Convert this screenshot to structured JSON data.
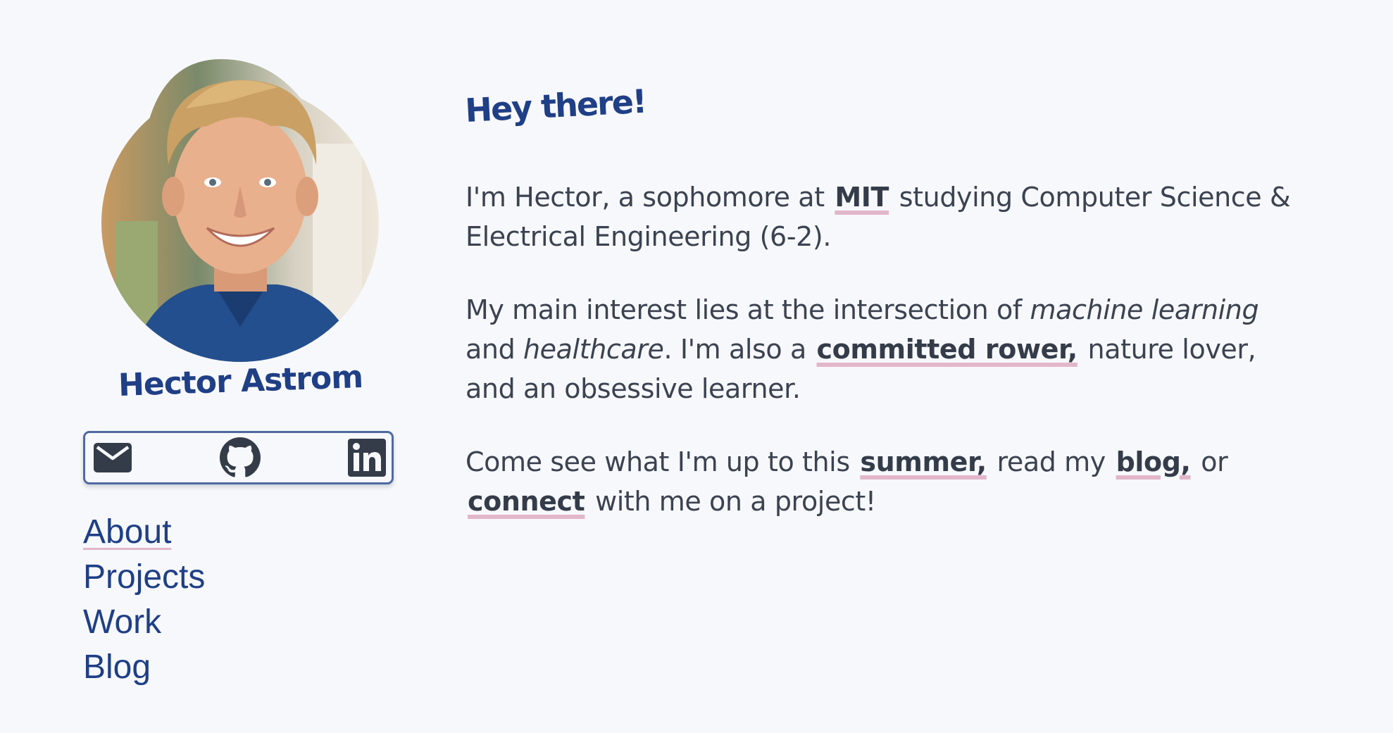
{
  "profile": {
    "name": "Hector Astrom",
    "avatar_alt": "profile-photo"
  },
  "social": [
    {
      "icon": "mail-icon"
    },
    {
      "icon": "github-icon"
    },
    {
      "icon": "linkedin-icon"
    }
  ],
  "nav": {
    "items": [
      {
        "label": "About",
        "active": true
      },
      {
        "label": "Projects"
      },
      {
        "label": "Work"
      },
      {
        "label": "Blog"
      }
    ]
  },
  "intro": {
    "greeting": "Hey there!",
    "p1": {
      "before": "I'm Hector, a sophomore at ",
      "link": "MIT",
      "after": " studying Computer Science & Electrical Engineering (6-2)."
    },
    "p2": {
      "before": "My main interest lies at the intersection of ",
      "em1": "machine learning",
      "mid1": " and ",
      "em2": "healthcare",
      "mid2": ". I'm also a ",
      "link": "committed rower,",
      "after": " nature lover, and an obsessive learner."
    },
    "p3": {
      "before": "Come see what I'm up to this ",
      "link1": "summer,",
      "mid1": " read my ",
      "link2": "blog,",
      "mid2": " or ",
      "link3": "connect",
      "after": " with me on a project!"
    }
  },
  "colors": {
    "background": "#f7f8fb",
    "accent_blue": "#1f3f86",
    "text": "#3b4250",
    "underline_pink": "#e2b6cb",
    "border": "#4f6aa0"
  }
}
